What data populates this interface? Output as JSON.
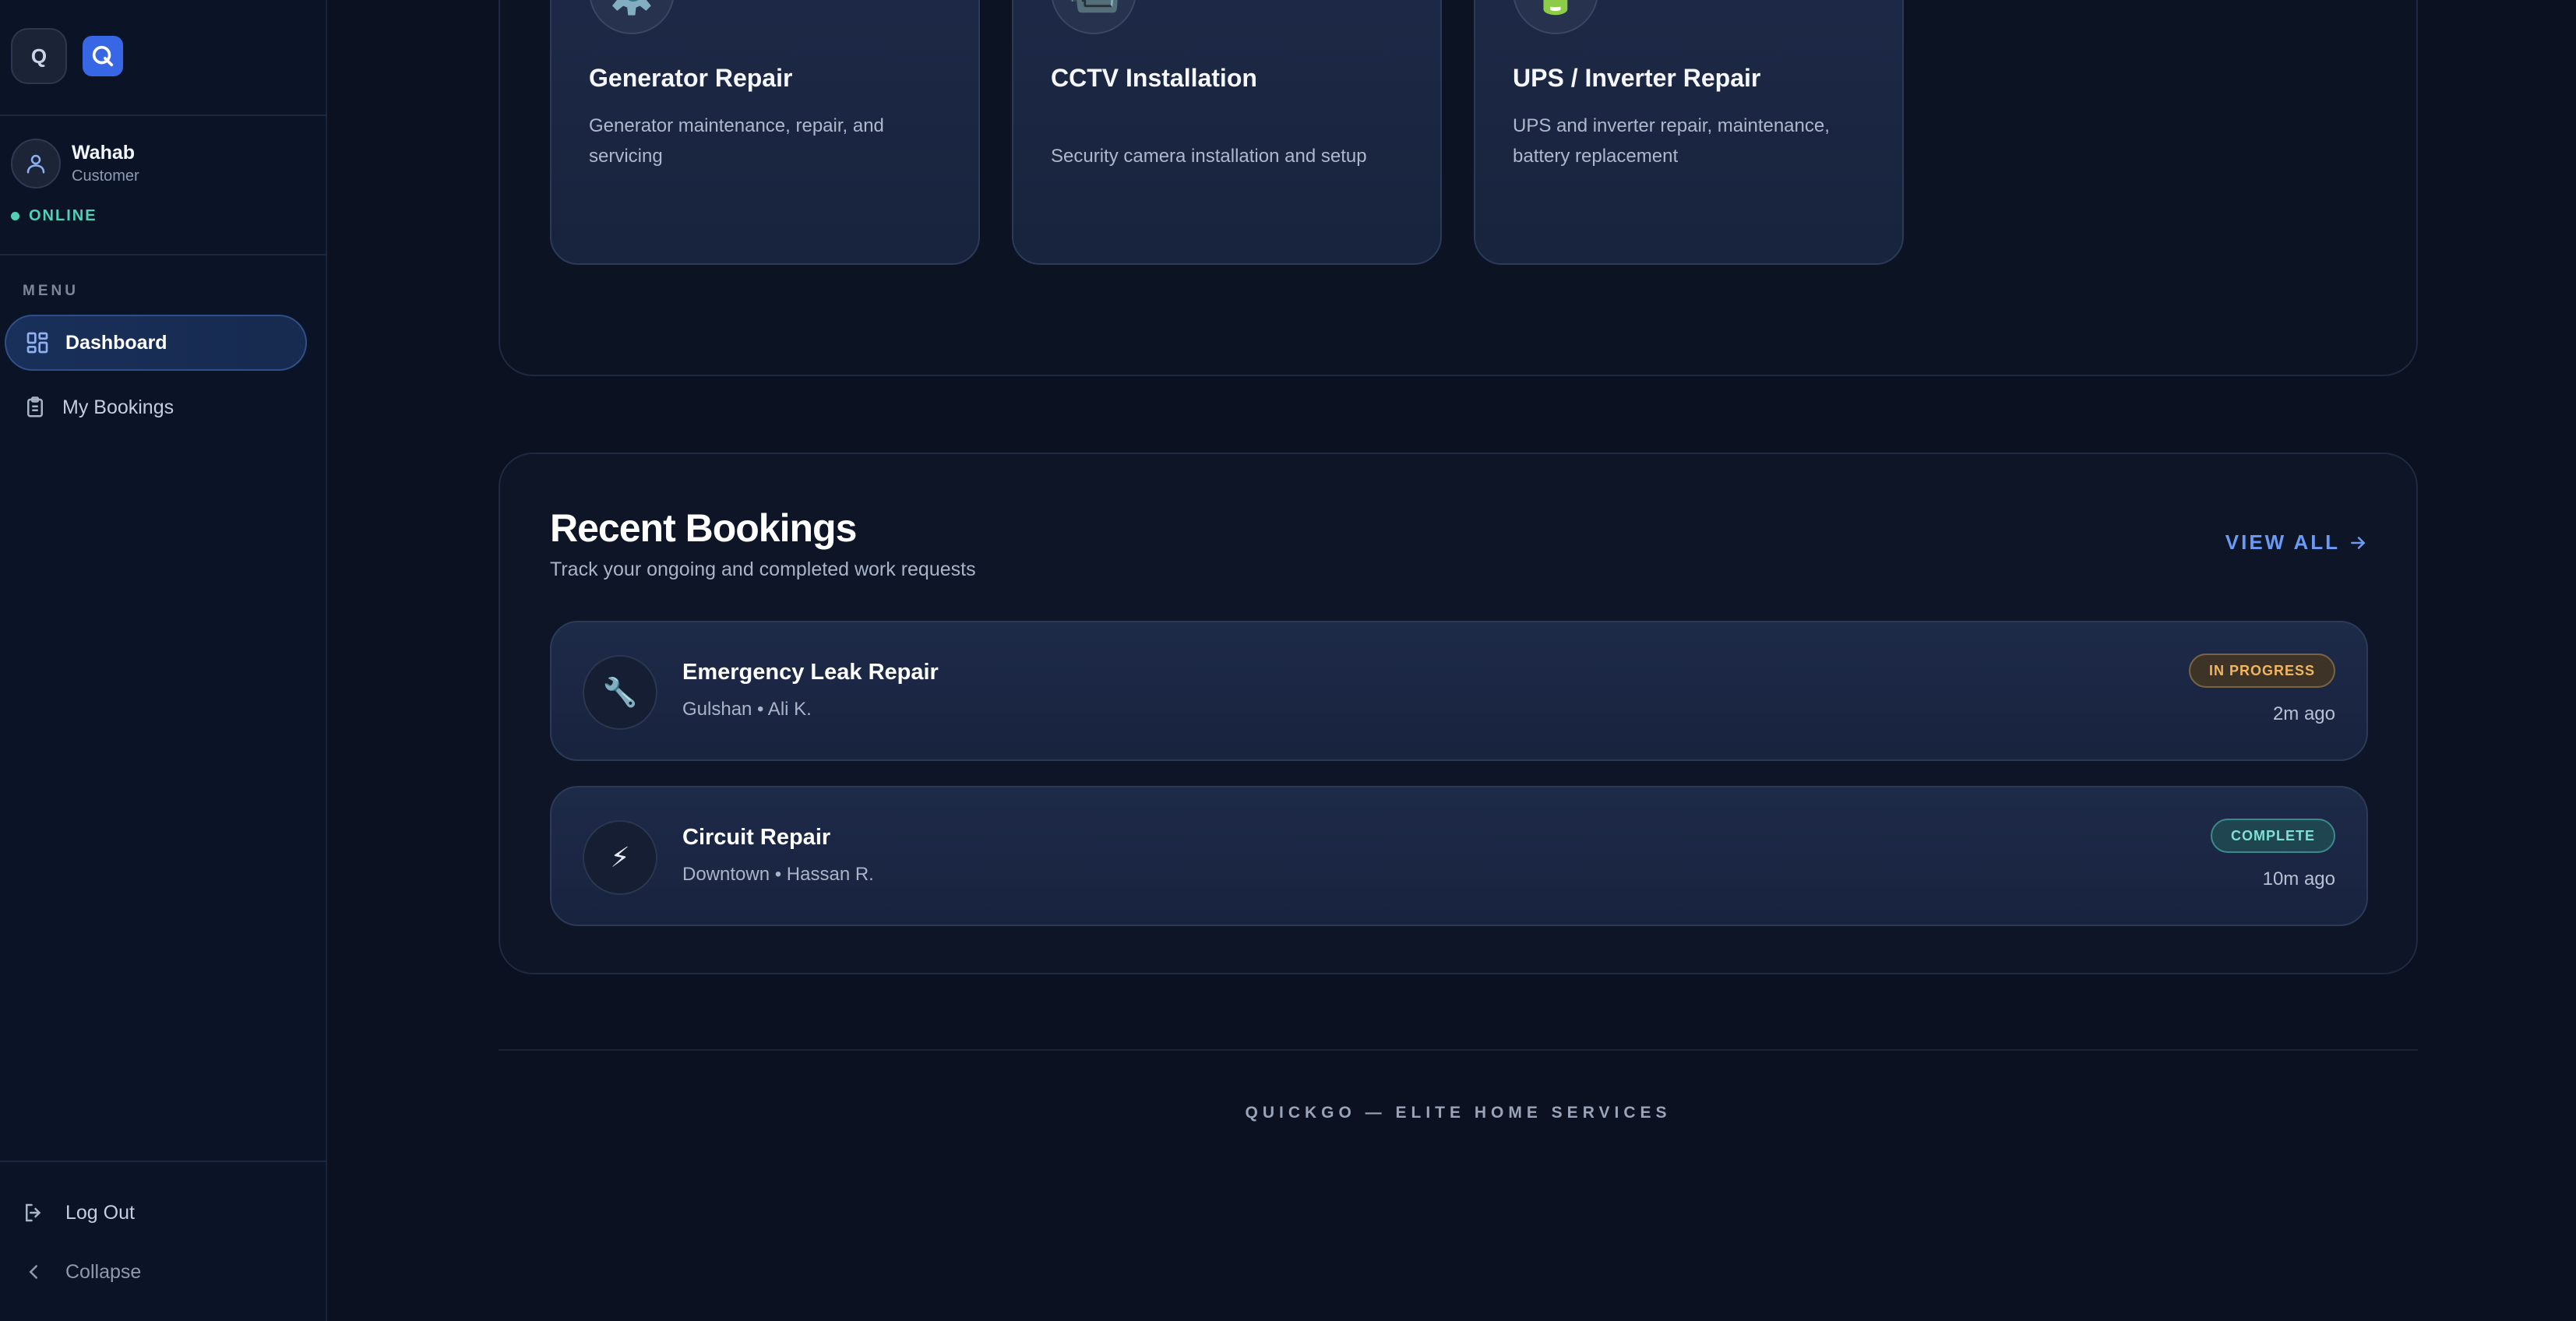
{
  "sidebar": {
    "logo_letter": "Q",
    "user": {
      "name": "Wahab",
      "role": "Customer",
      "status": "ONLINE"
    },
    "menu_label": "MENU",
    "items": [
      {
        "label": "Dashboard",
        "icon": "dashboard-icon",
        "active": true
      },
      {
        "label": "My Bookings",
        "icon": "clipboard-icon",
        "active": false
      }
    ],
    "logout_label": "Log Out",
    "collapse_label": "Collapse"
  },
  "services": [
    {
      "icon": "⚙️",
      "icon_name": "gear-icon",
      "title": "Generator Repair",
      "description": "Generator maintenance, repair, and servicing"
    },
    {
      "icon": "📹",
      "icon_name": "camera-icon",
      "title": "CCTV Installation",
      "description": "Security camera installation and setup"
    },
    {
      "icon": "🔋",
      "icon_name": "battery-icon",
      "title": "UPS / Inverter Repair",
      "description": "UPS and inverter repair, maintenance, battery replacement"
    }
  ],
  "bookings": {
    "title": "Recent Bookings",
    "subtitle": "Track your ongoing and completed work requests",
    "view_all": "VIEW ALL",
    "items": [
      {
        "icon": "🔧",
        "icon_name": "wrench-icon",
        "name": "Emergency Leak Repair",
        "meta": "Gulshan • Ali K.",
        "status": "IN PROGRESS",
        "time": "2m ago"
      },
      {
        "icon": "⚡",
        "icon_name": "lightning-icon",
        "name": "Circuit Repair",
        "meta": "Downtown • Hassan R.",
        "status": "COMPLETE",
        "time": "10m ago"
      }
    ]
  },
  "footer": {
    "text": "QUICKGO — ELITE HOME SERVICES"
  },
  "colors": {
    "accent": "#3867e6",
    "online": "#4fd1b5",
    "in_progress": "#f0b562",
    "complete": "#7fe0d4",
    "link": "#6b9af5"
  }
}
